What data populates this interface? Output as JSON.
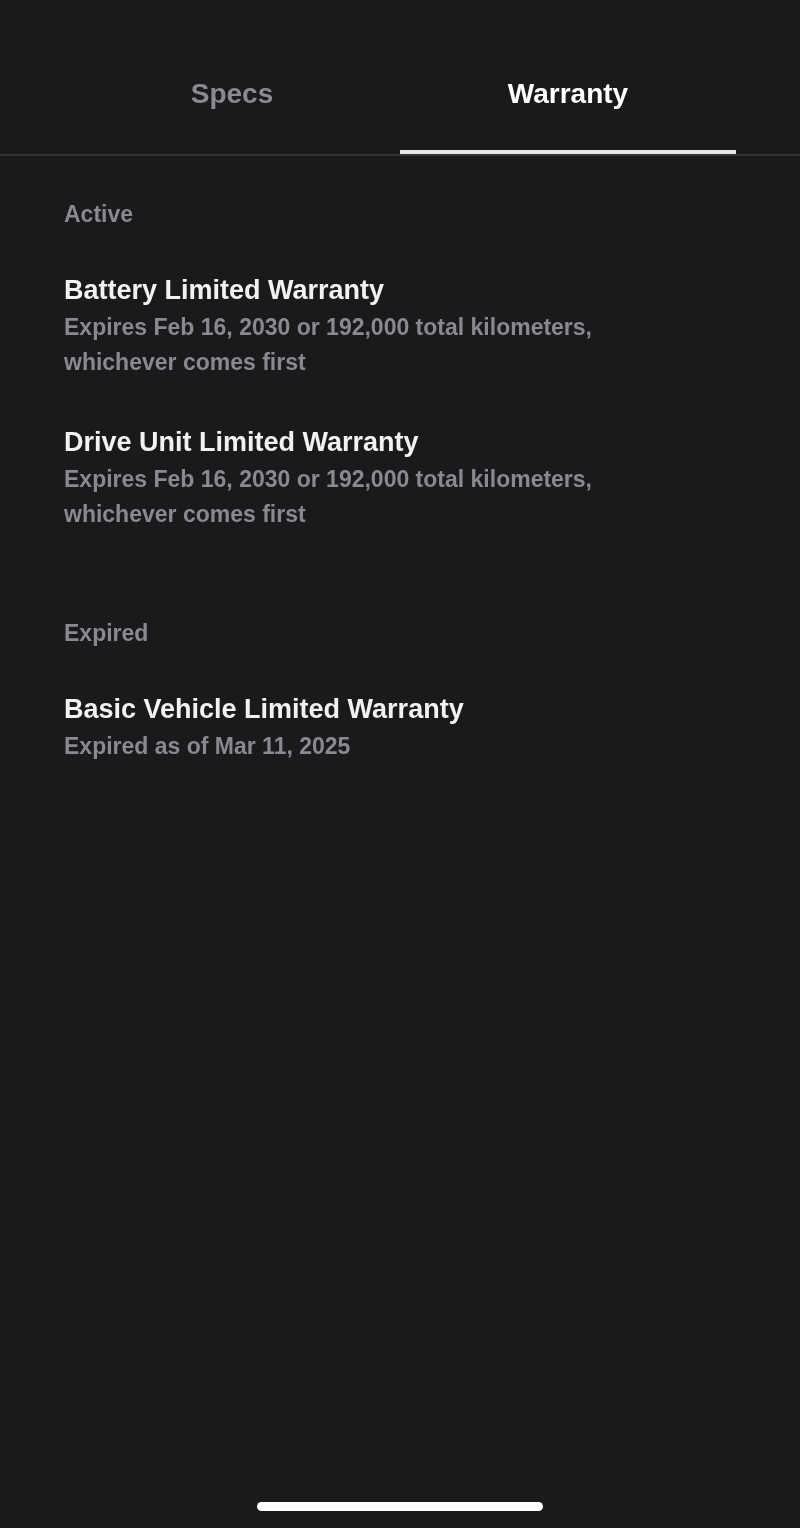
{
  "tabs": [
    {
      "label": "Specs",
      "selected": false
    },
    {
      "label": "Warranty",
      "selected": true
    }
  ],
  "sections": [
    {
      "label": "Active",
      "items": [
        {
          "title": "Battery Limited Warranty",
          "subtitle": "Expires Feb 16, 2030 or 192,000 total kilometers, whichever comes first"
        },
        {
          "title": "Drive Unit Limited Warranty",
          "subtitle": "Expires Feb 16, 2030 or 192,000 total kilometers, whichever comes first"
        }
      ]
    },
    {
      "label": "Expired",
      "items": [
        {
          "title": "Basic Vehicle Limited Warranty",
          "subtitle": "Expired as of Mar 11, 2025"
        }
      ]
    }
  ]
}
